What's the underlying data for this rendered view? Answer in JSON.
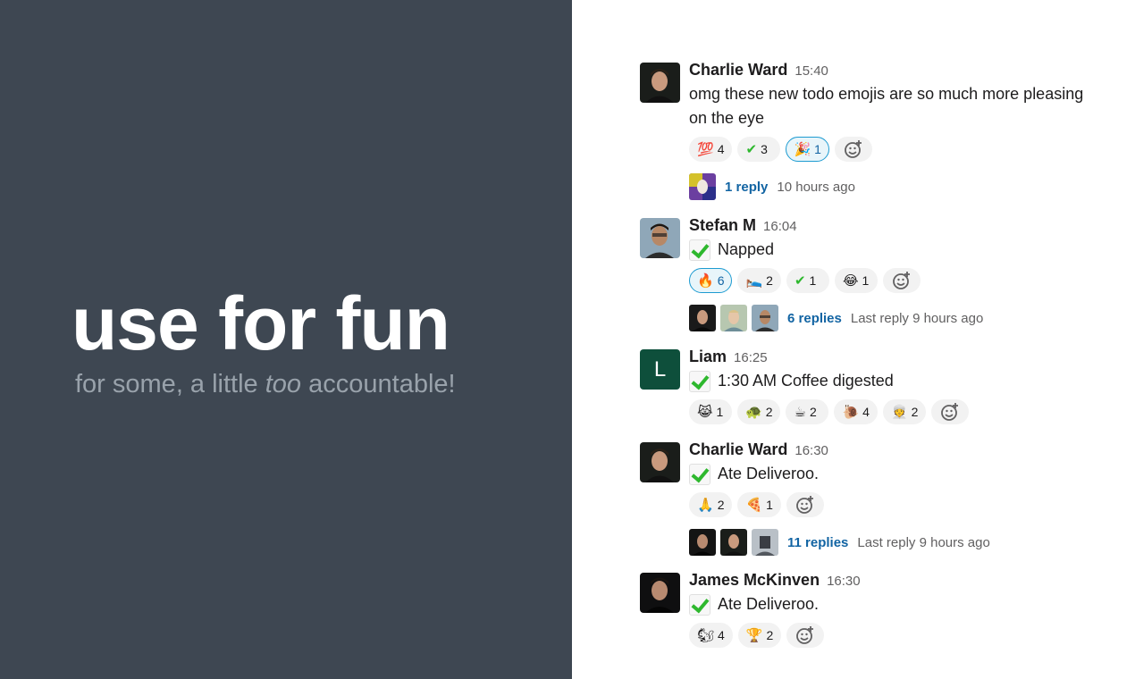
{
  "hero": {
    "title": "use for fun",
    "subtitle_prefix": "for some, a little ",
    "subtitle_emphasis": "too",
    "subtitle_suffix": " accountable!"
  },
  "colors": {
    "left_bg": "#3e4752",
    "link": "#1264a3",
    "check": "#2eb82e",
    "active_reaction_border": "#1d9bd1"
  },
  "messages": [
    {
      "author": "Charlie Ward",
      "time": "15:40",
      "text": "omg these new todo emojis are so much more pleasing on the eye",
      "reactions": [
        {
          "emoji": "💯",
          "count": "4"
        },
        {
          "emoji": "✔",
          "count": "3"
        },
        {
          "emoji": "🎉",
          "count": "1",
          "active": true
        }
      ],
      "thread": {
        "replies": "1 reply",
        "meta": "10 hours ago"
      }
    },
    {
      "author": "Stefan M",
      "time": "16:04",
      "text": "Napped",
      "reactions": [
        {
          "emoji": "🔥",
          "count": "6",
          "active": true
        },
        {
          "emoji": "🛌",
          "count": "2"
        },
        {
          "emoji": "✔",
          "count": "1"
        },
        {
          "emoji": "😂",
          "count": "1"
        }
      ],
      "thread": {
        "replies": "6 replies",
        "meta": "Last reply 9 hours ago"
      }
    },
    {
      "author": "Liam",
      "avatar_letter": "L",
      "time": "16:25",
      "text": "1:30 AM Coffee digested",
      "reactions": [
        {
          "emoji": "😹",
          "count": "1"
        },
        {
          "emoji": "🐢",
          "count": "2"
        },
        {
          "emoji": "☕",
          "count": "2"
        },
        {
          "emoji": "🐌",
          "count": "4"
        },
        {
          "emoji": "👳",
          "count": "2"
        }
      ]
    },
    {
      "author": "Charlie Ward",
      "time": "16:30",
      "text": "Ate Deliveroo.",
      "reactions": [
        {
          "emoji": "🙏",
          "count": "2"
        },
        {
          "emoji": "🍕",
          "count": "1"
        }
      ],
      "thread": {
        "replies": "11 replies",
        "meta": "Last reply 9 hours ago"
      }
    },
    {
      "author": "James McKinven",
      "time": "16:30",
      "text": "Ate Deliveroo.",
      "reactions": [
        {
          "emoji": "🐿",
          "count": "4"
        },
        {
          "emoji": "🏆",
          "count": "2"
        }
      ]
    }
  ],
  "icons": {
    "add_reaction": "add-reaction-icon",
    "todo_check": "checkbox-checked-icon"
  }
}
